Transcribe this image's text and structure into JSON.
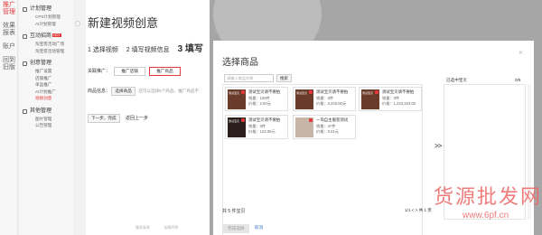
{
  "vnav": [
    "推广管理",
    "效果报表",
    "账户",
    "回到旧版"
  ],
  "sidebar": [
    {
      "head": "计划管理",
      "items": [
        "CPS计划管理",
        "AI计划管理"
      ]
    },
    {
      "head": "互动招商",
      "hot": "HOT",
      "items": [
        "淘宝客活动广场",
        "淘宝客活动管理"
      ]
    },
    {
      "head": "创意管理",
      "items": [
        "推广设置",
        "店铺推广",
        "单品推广",
        "AI计划推广",
        "视频创意"
      ],
      "selected": 4
    },
    {
      "head": "其他管理",
      "items": [
        "图片管理",
        "公告管理"
      ]
    }
  ],
  "page": {
    "title": "新建视频创意",
    "steps": [
      "1 选择视频",
      "2 填写视频信息",
      "3 填写"
    ],
    "link_type_label": "关联推广：",
    "opt_shop": "推广店铺",
    "opt_product": "推广商品",
    "product_label": "商品信息：",
    "select_product_btn": "选择商品",
    "product_hint": "还可以选择5个商品，推广商品不",
    "next_btn": "下一步，完成",
    "back_link": "返回上一步",
    "footer": [
      "服务条款",
      "法律声明"
    ]
  },
  "modal": {
    "title": "选择商品",
    "close": "×",
    "search_placeholder": "请输入商品名称",
    "search_btn": "搜索",
    "products": [
      {
        "name": "测试宝贝请不要拍",
        "sales": "销量：139件",
        "price": "价格：2.00元",
        "img": "测试宝贝",
        "tone": "mid"
      },
      {
        "name": "测试宝贝请不要拍",
        "sales": "销量：0件",
        "price": "价格：3,333.00元",
        "img": "测试宝贝",
        "tone": "mid"
      },
      {
        "name": "测试宝贝请不要拍",
        "sales": "销量：0件",
        "price": "价格：1,233,333.00",
        "img": "测试宝贝",
        "tone": "mid"
      },
      {
        "name": "测试宝贝请不要拍",
        "sales": "销量：0件",
        "price": "价格：123.00元",
        "img": "测试宝贝",
        "tone": "dark"
      },
      {
        "name": "一淘自主服装测试",
        "sales": "销量：47件",
        "price": "价格：0.01元",
        "img": "",
        "tone": "light"
      }
    ],
    "total": "共 5 件宝贝",
    "page_current": "1/1",
    "page_total": "共 1 页",
    "arrow": ">>",
    "selected_label": "已选中宝贝",
    "selected_count": "0/5",
    "ok_btn": "完成选择",
    "cancel": "取消"
  },
  "watermark": {
    "cn": "货源批发网",
    "url": "www.6pf.cn"
  }
}
